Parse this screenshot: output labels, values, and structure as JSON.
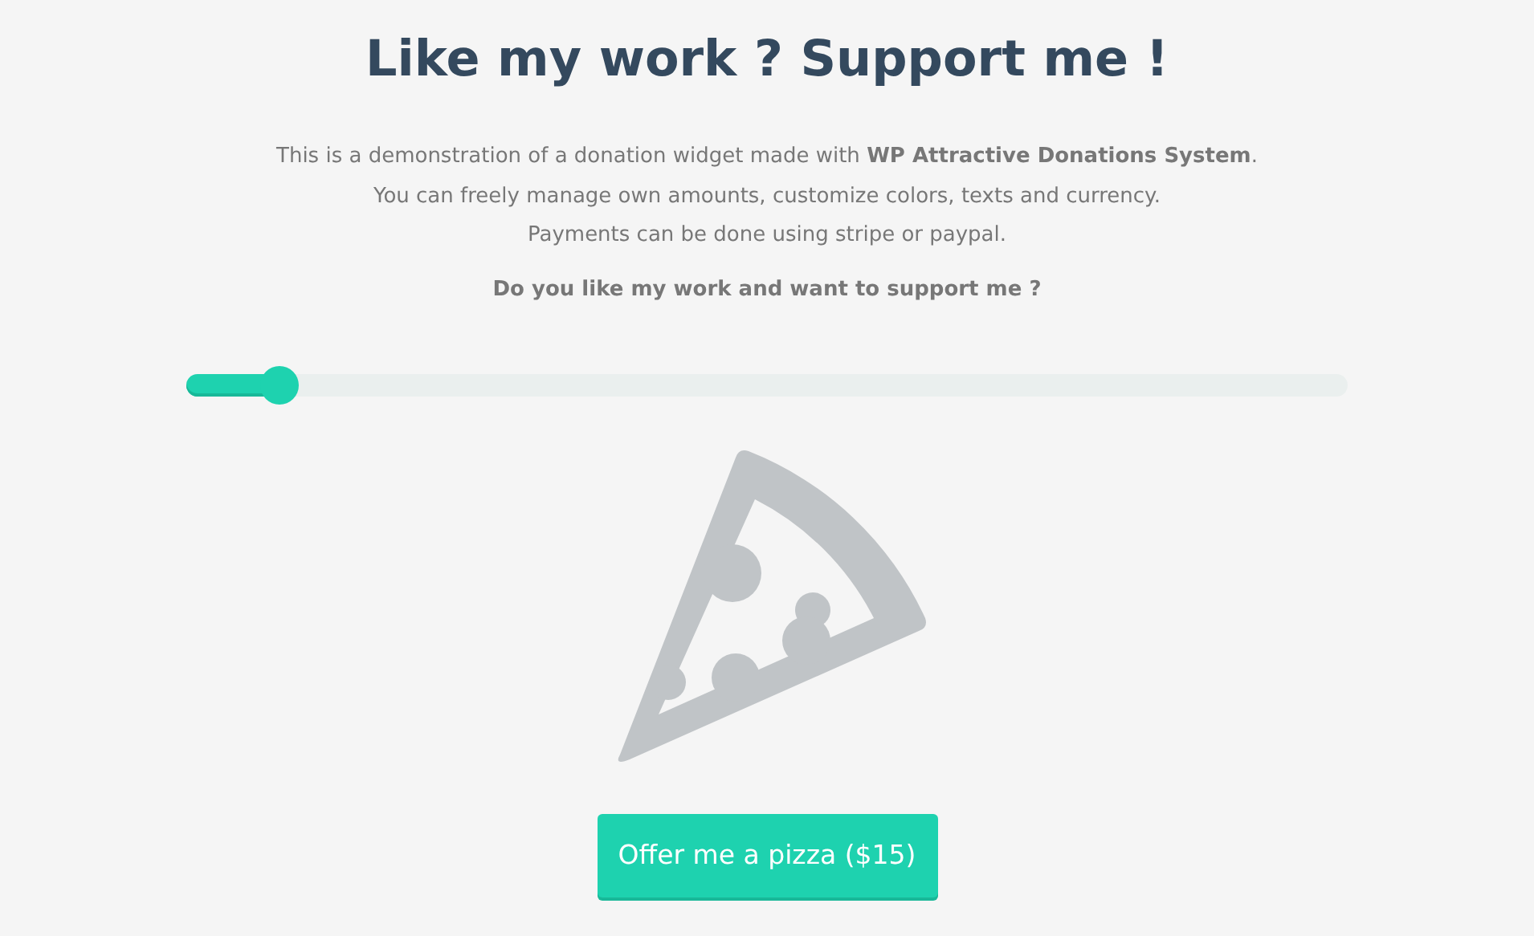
{
  "title": "Like my work ? Support me !",
  "description": [
    "This is a demonstration of a donation widget made with **WP Attractive Donations System**.",
    "You can freely manage own amounts, customize colors, texts and currency.",
    "Payments can be done using stripe or paypal."
  ],
  "question": "Do you like my work and want to support me ?",
  "slider": {
    "level": 0.08
  },
  "button": {
    "label": "Offer me a pizza ($15)"
  }
}
